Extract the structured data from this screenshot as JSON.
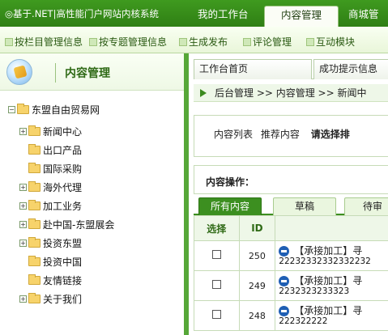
{
  "topbar": {
    "title": "◎基于.NET|高性能门户网站内核系统",
    "tabs": [
      "我的工作台",
      "内容管理",
      "商城管"
    ]
  },
  "subbar": {
    "items": [
      "按栏目管理信息",
      "按专题管理信息",
      "生成发布",
      "评论管理",
      "互动模块"
    ]
  },
  "left": {
    "title": "内容管理",
    "tree_root": "东盟自由贸易网",
    "nodes": [
      {
        "label": "新闻中心",
        "expandable": true
      },
      {
        "label": "出口产品",
        "expandable": false
      },
      {
        "label": "国际采购",
        "expandable": false
      },
      {
        "label": "海外代理",
        "expandable": true
      },
      {
        "label": "加工业务",
        "expandable": true
      },
      {
        "label": "赴中国-东盟展会",
        "expandable": true
      },
      {
        "label": "投资东盟",
        "expandable": true
      },
      {
        "label": "投资中国",
        "expandable": false
      },
      {
        "label": "友情链接",
        "expandable": false
      },
      {
        "label": "关于我们",
        "expandable": true
      }
    ]
  },
  "right": {
    "tabs": [
      "工作台首页",
      "成功提示信息"
    ],
    "breadcrumb": "后台管理 >> 内容管理 >> 新闻中",
    "list_links": [
      "内容列表",
      "推荐内容"
    ],
    "list_prompt": "请选择排",
    "ops_label": "内容操作：",
    "content_tabs": [
      "所有内容",
      "草稿",
      "待审"
    ],
    "table": {
      "headers": [
        "选择",
        "ID",
        ""
      ],
      "rows": [
        {
          "id": "250",
          "title": "【承接加工】寻",
          "sub": "22232332332332232"
        },
        {
          "id": "249",
          "title": "【承接加工】寻",
          "sub": "2232323233323"
        },
        {
          "id": "248",
          "title": "【承接加工】寻",
          "sub": "222322222"
        }
      ]
    }
  }
}
